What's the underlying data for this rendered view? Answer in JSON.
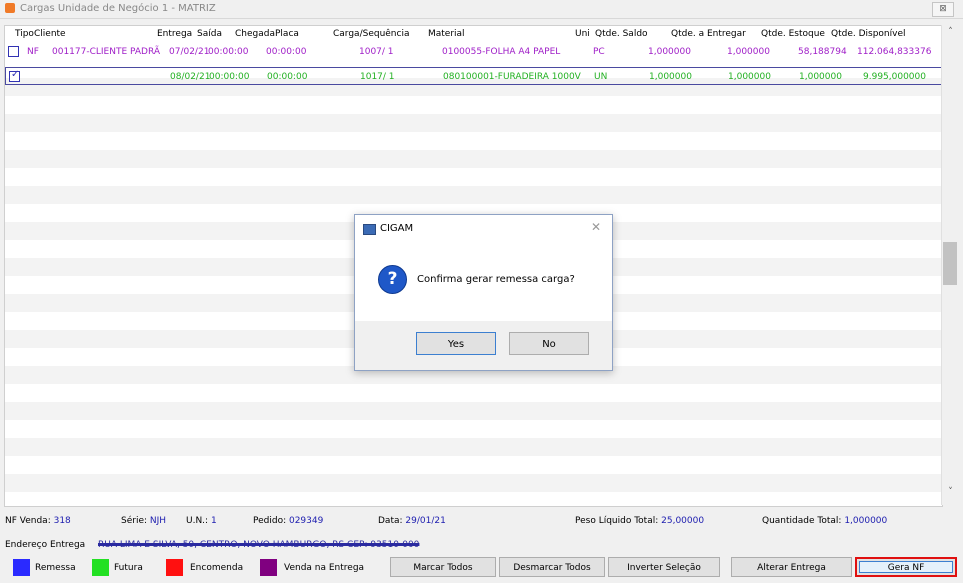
{
  "window": {
    "title": "Cargas Unidade de Negócio 1 - MATRIZ",
    "close_label": "⊠"
  },
  "grid": {
    "columns": [
      "Tipo",
      "Cliente",
      "Entrega",
      "Saída",
      "Chegada",
      "Placa",
      "Carga/Sequência",
      "Material",
      "Uni",
      "Qtde. Saldo",
      "Qtde. a Entregar",
      "Qtde. Estoque",
      "Qtde. Disponível"
    ],
    "rows": [
      {
        "checked": false,
        "color": "#a020c8",
        "cells": [
          "NF",
          "001177-CLIENTE PADRÃ",
          "07/02/21",
          "00:00:00",
          "00:00:00",
          "",
          "1007/ 1",
          "0100055-FOLHA A4 PAPEL",
          "PC",
          "1,000000",
          "1,000000",
          "58,188794",
          "112.064,833376"
        ]
      },
      {
        "checked": true,
        "color": "#22b022",
        "cells": [
          "",
          "",
          "08/02/21",
          "00:00:00",
          "00:00:00",
          "",
          "1017/ 1",
          "080100001-FURADEIRA 1000V",
          "UN",
          "1,000000",
          "1,000000",
          "1,000000",
          "9.995,000000"
        ]
      }
    ]
  },
  "footer": {
    "nf_venda_label": "NF Venda:",
    "nf_venda_value": "318",
    "serie_label": "Série:",
    "serie_value": "NJH",
    "un_label": "U.N.:",
    "un_value": "1",
    "pedido_label": "Pedido:",
    "pedido_value": "029349",
    "data_label": "Data:",
    "data_value": "29/01/21",
    "peso_label": "Peso Líquido Total:",
    "peso_value": "25,00000",
    "quantidade_label": "Quantidade Total:",
    "quantidade_value": "1,000000",
    "endereco_label": "Endereço Entrega",
    "endereco_value": "RUA LIMA E SILVA, 50, CENTRO, NOVO HAMBURGO, RS CEP: 93510-000"
  },
  "legend": [
    {
      "label": "Remessa",
      "color": "#2a2aff"
    },
    {
      "label": "Futura",
      "color": "#22e022"
    },
    {
      "label": "Encomenda",
      "color": "#ff1010"
    },
    {
      "label": "Venda na Entrega",
      "color": "#800080"
    }
  ],
  "buttons": {
    "marcar_todos": "Marcar Todos",
    "desmarcar_todos": "Desmarcar Todos",
    "inverter_selecao": "Inverter Seleção",
    "alterar_entrega": "Alterar Entrega",
    "gera_nf": "Gera NF"
  },
  "dialog": {
    "title": "CIGAM",
    "message": "Confirma gerar remessa carga?",
    "yes_label": "Yes",
    "no_label": "No",
    "close_label": "✕"
  }
}
